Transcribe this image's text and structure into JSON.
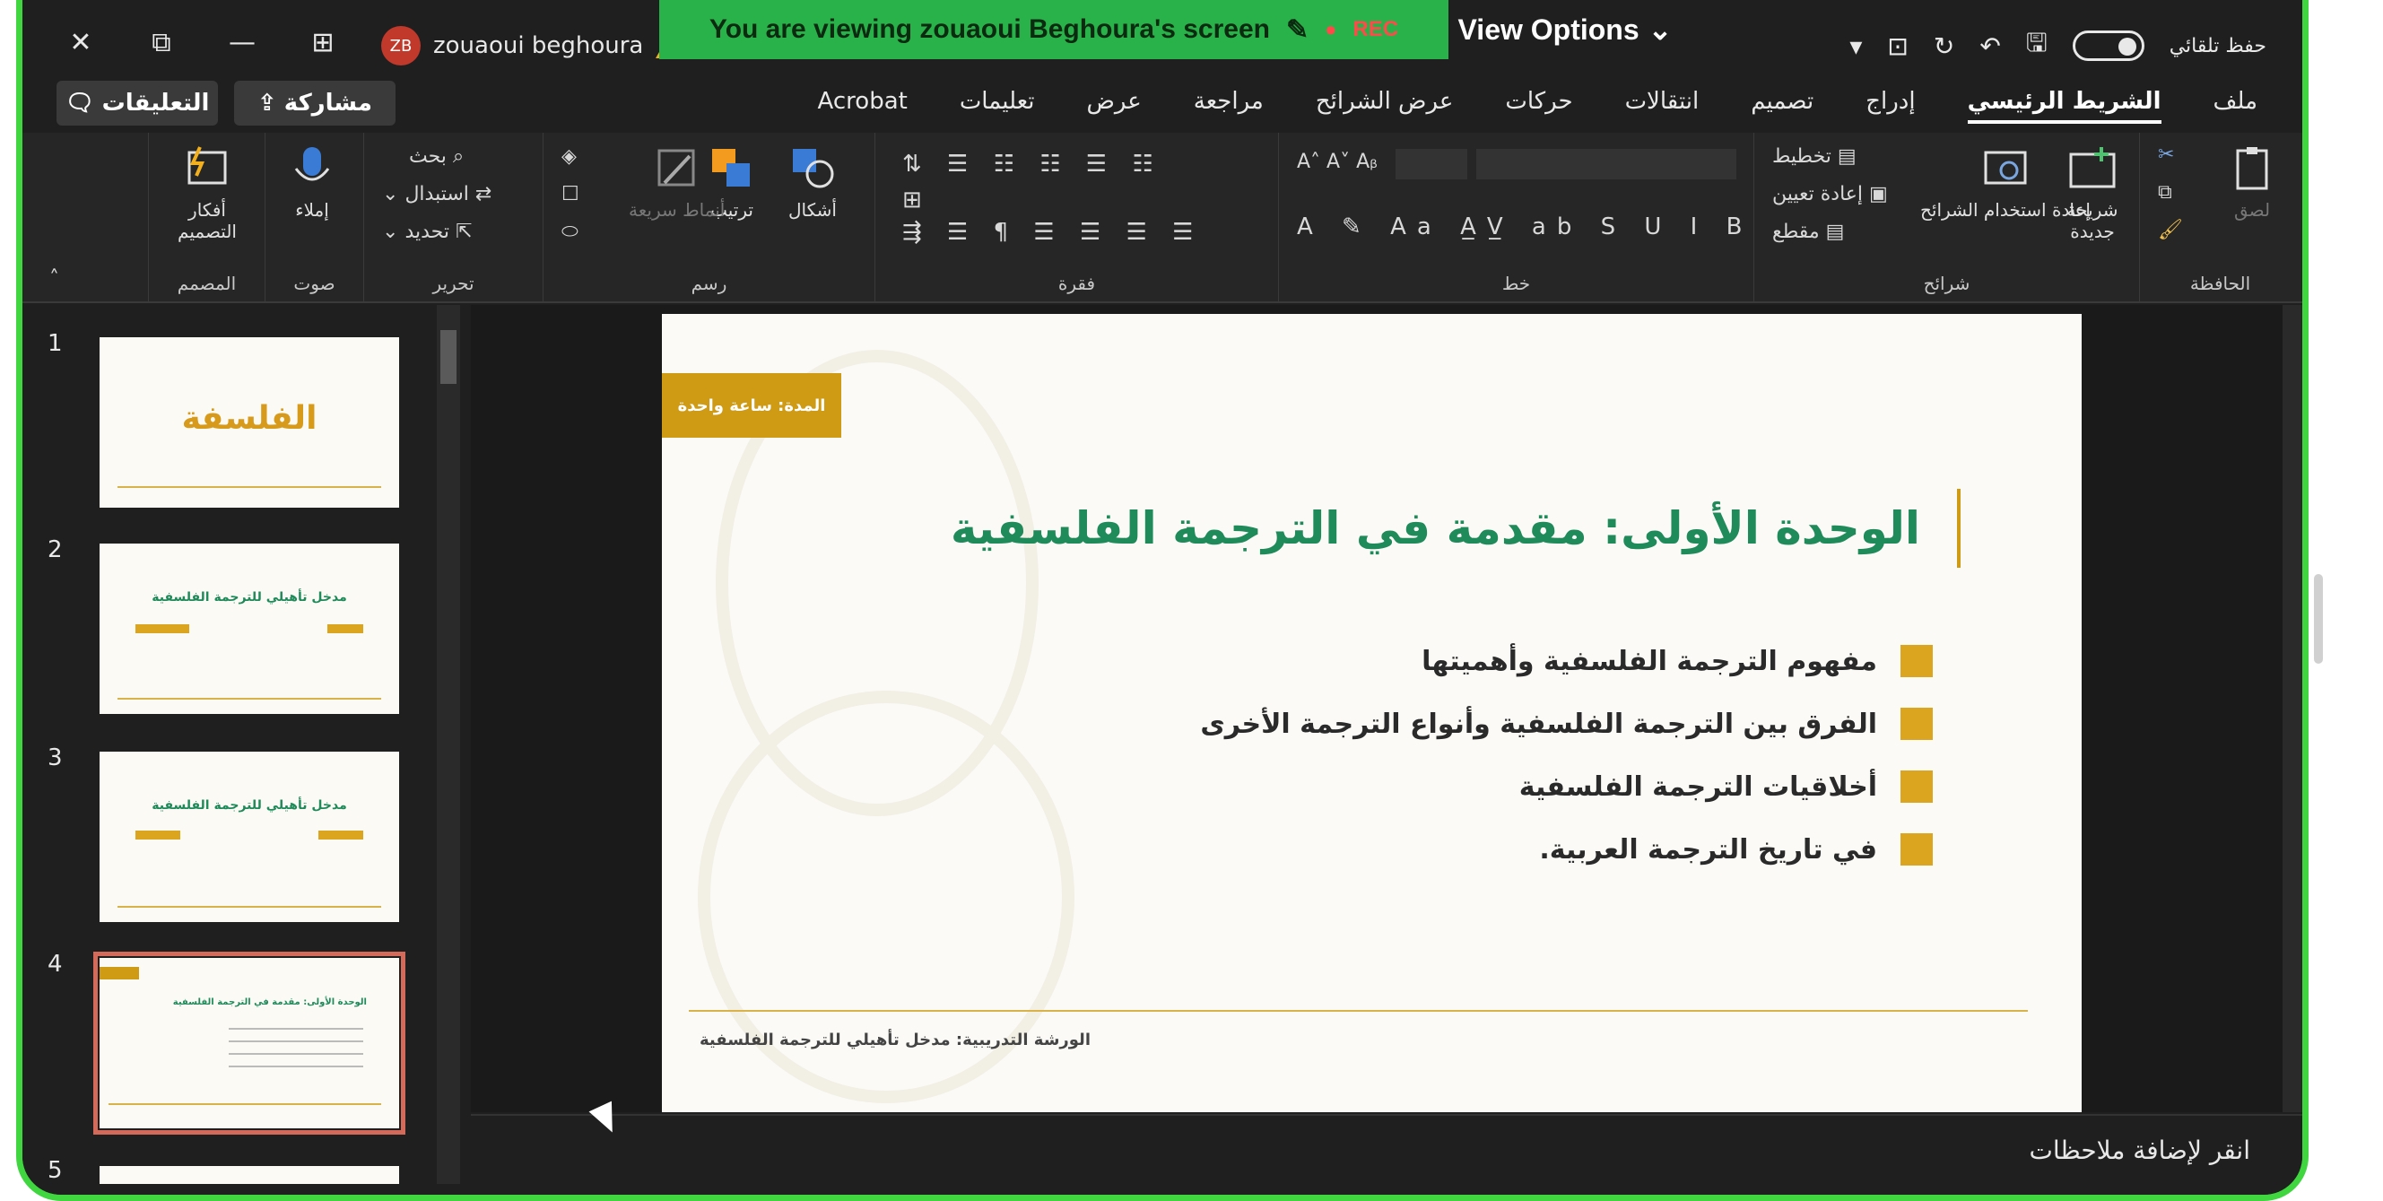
{
  "zoom_overlay": {
    "user_name": "zouaoui beghoura",
    "avatar_initials": "ZB",
    "viewing_banner": "You are viewing  zouaoui Beghoura's screen",
    "rec_label": "REC",
    "view_options": "View Options"
  },
  "window_buttons": {
    "close": "✕",
    "restore": "⧉",
    "minimize": "—",
    "present": "⊞"
  },
  "quick_access": {
    "autosave_label": "حفظ تلقائي"
  },
  "tabs": [
    "ملف",
    "الشريط الرئيسي",
    "إدراج",
    "تصميم",
    "انتقالات",
    "حركات",
    "عرض الشرائح",
    "مراجعة",
    "عرض",
    "تعليمات",
    "Acrobat"
  ],
  "active_tab": "الشريط الرئيسي",
  "share_label": "مشاركة",
  "comments_label": "التعليقات",
  "ribbon": {
    "groups": [
      {
        "label": "الحافظة"
      },
      {
        "label": "شرائح"
      },
      {
        "label": "خط"
      },
      {
        "label": "فقرة"
      },
      {
        "label": "رسم"
      },
      {
        "label": "تحرير"
      },
      {
        "label": "صوت"
      },
      {
        "label": "المصمم"
      }
    ],
    "clipboard_paste": "لصق",
    "new_slide": "شريحة جديدة",
    "reuse_slides": "إعادة استخدام الشرائح",
    "layout": "تخطيط",
    "reset": "إعادة تعيين",
    "section": "مقطع",
    "shapes": "أشكال",
    "arrange": "ترتيب",
    "quick_styles": "أنماط سريعة",
    "find": "بحث",
    "replace": "استبدال",
    "select": "تحديد",
    "dictate": "إملاء",
    "designer": "أفكار التصميم"
  },
  "thumbnails": [
    {
      "num": "1",
      "text": "الفلسفة"
    },
    {
      "num": "2",
      "text": "مدخل تأهيلي للترجمة الفلسفية"
    },
    {
      "num": "3",
      "text": "مدخل تأهيلي للترجمة الفلسفية"
    },
    {
      "num": "4",
      "text": "الوحدة الأولى: مقدمة في الترجمة الفلسفية"
    },
    {
      "num": "5",
      "text": ""
    }
  ],
  "slide": {
    "tag": "المدة: ساعة واحدة",
    "title": "الوحدة الأولى: مقدمة في الترجمة الفلسفية",
    "bullets": [
      "مفهوم الترجمة الفلسفية وأهميتها",
      "الفرق بين الترجمة الفلسفية وأنواع الترجمة الأخرى",
      "أخلاقيات الترجمة الفلسفية",
      "في تاريخ الترجمة العربية."
    ],
    "footer": "الورشة التدريبية: مدخل تأهيلي للترجمة الفلسفية"
  },
  "notes_placeholder": "انقر لإضافة ملاحظات",
  "colors": {
    "banner": "#2ab24a",
    "border": "#3fd63f",
    "accent": "#dba51f",
    "title": "#1f8a5a"
  }
}
